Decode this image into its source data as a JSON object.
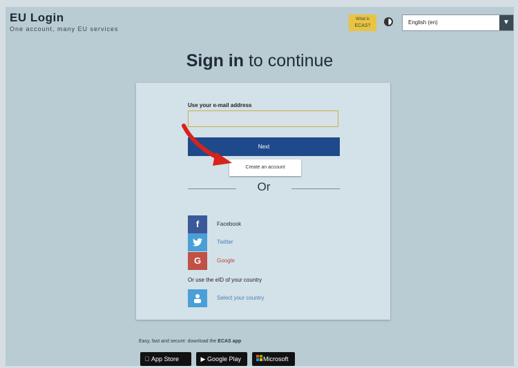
{
  "header": {
    "brand_title": "EU Login",
    "brand_subtitle": "One account, many EU services",
    "ecas_badge_top": "What is",
    "ecas_badge_bottom": "ECAS?",
    "language_value": "English (en)"
  },
  "main": {
    "heading_bold": "Sign in",
    "heading_rest": " to continue",
    "email_label": "Use your e-mail address",
    "email_value": "",
    "next_label": "Next",
    "create_account_label": "Create an account",
    "or_text": "Or",
    "social": [
      {
        "label": "Facebook",
        "icon": "facebook-icon",
        "color": "#3b5998",
        "label_color": "#1f2c38"
      },
      {
        "label": "Twitter",
        "icon": "twitter-icon",
        "color": "#4b9fd8",
        "label_color": "#4a7fb3"
      },
      {
        "label": "Google",
        "icon": "google-icon",
        "color": "#c05147",
        "label_color": "#b8473f"
      }
    ],
    "eid_label": "Or use the eID of your country",
    "eid_link": "Select your country"
  },
  "footer": {
    "text_prefix": "Easy, fast and secure: download the ",
    "text_bold": "ECAS app",
    "app_store_label": "App Store",
    "google_play_label": "Google Play",
    "microsoft_label": "Microsoft"
  },
  "colors": {
    "primary": "#1e4a8c",
    "accent_yellow": "#e8c440",
    "annotation_arrow": "#d6231c"
  }
}
